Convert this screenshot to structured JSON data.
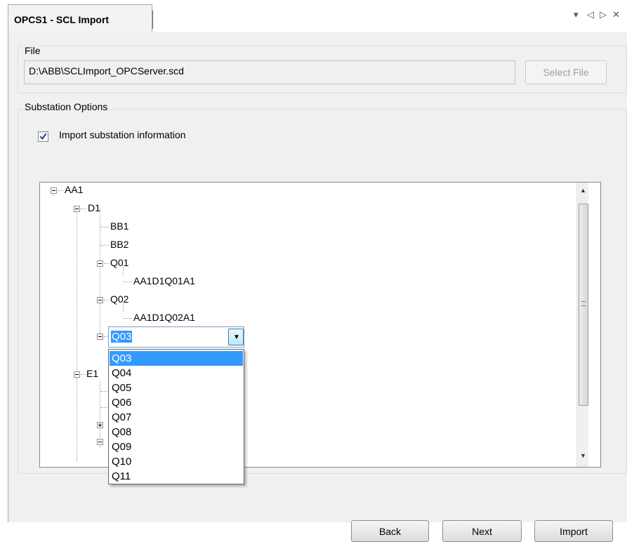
{
  "tab": {
    "title": "OPCS1 - SCL Import",
    "controls": [
      "▾",
      "◁",
      "▷",
      "✕"
    ]
  },
  "file_group": {
    "title": "File",
    "path": "D:\\ABB\\SCLImport_OPCServer.scd",
    "select_label": "Select File"
  },
  "options_group": {
    "title": "Substation Options",
    "checkbox_label": "Import substation information",
    "checked": true
  },
  "tree": {
    "nodes": [
      "AA1",
      "D1",
      "BB1",
      "BB2",
      "Q01",
      "AA1D1Q01A1",
      "Q02",
      "AA1D1Q02A1",
      "E1"
    ]
  },
  "combo": {
    "value": "Q03",
    "options": [
      "Q03",
      "Q04",
      "Q05",
      "Q06",
      "Q07",
      "Q08",
      "Q09",
      "Q10",
      "Q11"
    ]
  },
  "buttons": {
    "back": "Back",
    "next": "Next",
    "import": "Import"
  },
  "colors": {
    "selection": "#3399ff",
    "panel": "#f0f0f0",
    "tree_bg": "#ffffff"
  }
}
